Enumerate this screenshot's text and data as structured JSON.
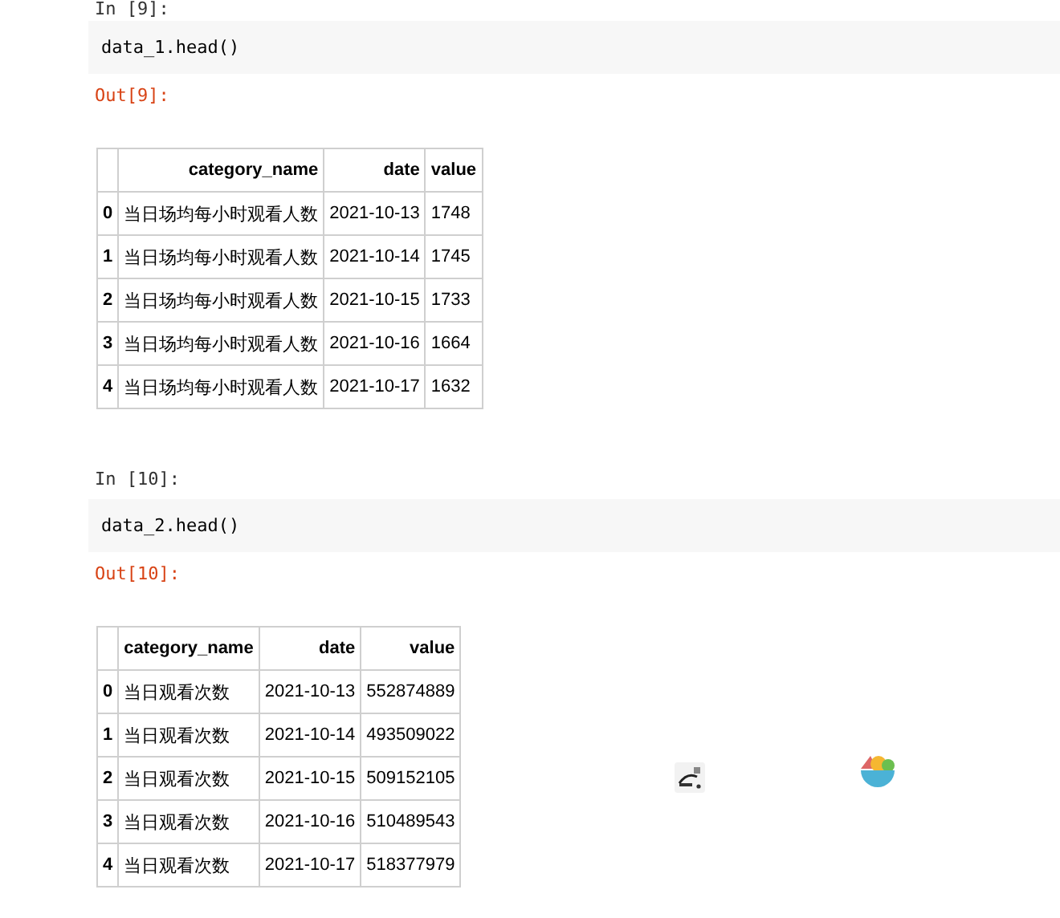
{
  "cells": [
    {
      "in_prompt": "In [9]:",
      "code": "data_1.head()",
      "out_prompt": "Out[9]:",
      "table": {
        "columns": [
          "category_name",
          "date",
          "value"
        ],
        "rows": [
          {
            "index": "0",
            "cells": [
              "当日场均每小时观看人数",
              "2021-10-13",
              "1748"
            ]
          },
          {
            "index": "1",
            "cells": [
              "当日场均每小时观看人数",
              "2021-10-14",
              "1745"
            ]
          },
          {
            "index": "2",
            "cells": [
              "当日场均每小时观看人数",
              "2021-10-15",
              "1733"
            ]
          },
          {
            "index": "3",
            "cells": [
              "当日场均每小时观看人数",
              "2021-10-16",
              "1664"
            ]
          },
          {
            "index": "4",
            "cells": [
              "当日场均每小时观看人数",
              "2021-10-17",
              "1632"
            ]
          }
        ]
      }
    },
    {
      "in_prompt": "In [10]:",
      "code": "data_2.head()",
      "out_prompt": "Out[10]:",
      "table": {
        "columns": [
          "category_name",
          "date",
          "value"
        ],
        "rows": [
          {
            "index": "0",
            "cells": [
              "当日观看次数",
              "2021-10-13",
              "552874889"
            ]
          },
          {
            "index": "1",
            "cells": [
              "当日观看次数",
              "2021-10-14",
              "493509022"
            ]
          },
          {
            "index": "2",
            "cells": [
              "当日观看次数",
              "2021-10-15",
              "509152105"
            ]
          },
          {
            "index": "3",
            "cells": [
              "当日观看次数",
              "2021-10-16",
              "510489543"
            ]
          },
          {
            "index": "4",
            "cells": [
              "当日观看次数",
              "2021-10-17",
              "518377979"
            ]
          }
        ]
      }
    }
  ]
}
